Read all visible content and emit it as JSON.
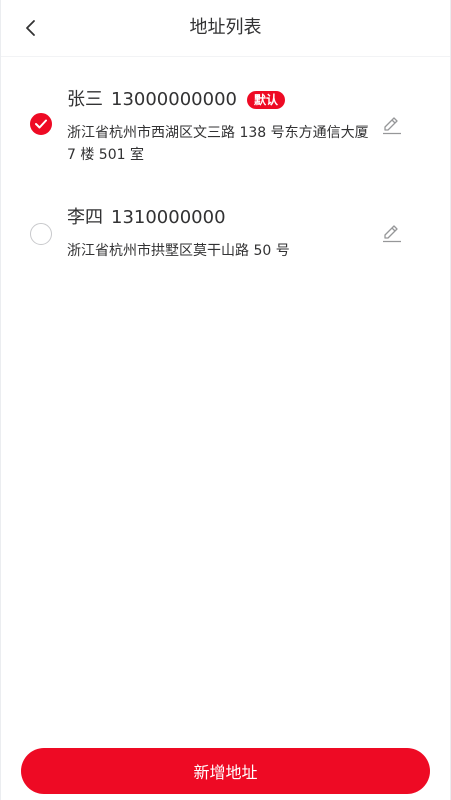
{
  "header": {
    "title": "地址列表",
    "back_icon": "chevron-left-icon"
  },
  "addresses": [
    {
      "name": "张三",
      "phone": "13000000000",
      "tag": "默认",
      "detail": "浙江省杭州市西湖区文三路 138 号东方通信大厦 7 楼 501 室",
      "selected": true
    },
    {
      "name": "李四",
      "phone": "1310000000",
      "tag": "",
      "detail": "浙江省杭州市拱墅区莫干山路 50 号",
      "selected": false
    }
  ],
  "footer": {
    "add_label": "新增地址"
  },
  "colors": {
    "accent": "#ee0a24",
    "text": "#323233",
    "icon_gray": "#969799",
    "radio_border": "#c8c9cc"
  }
}
